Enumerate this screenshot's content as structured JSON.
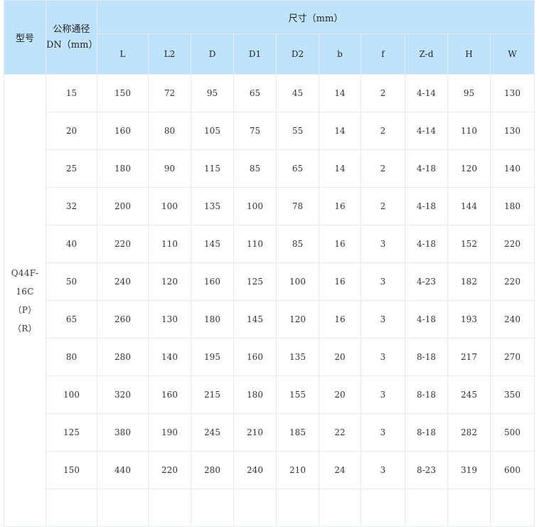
{
  "header": {
    "model_label": "型号",
    "dn_label_line1": "公称通径",
    "dn_label_line2": "DN（mm）",
    "dim_label": "尺寸（mm）",
    "columns": [
      "L",
      "L2",
      "D",
      "D1",
      "D2",
      "b",
      "f",
      "Z-d",
      "H",
      "W"
    ]
  },
  "model": {
    "line1": "Q44F-16C",
    "line2": "（P）",
    "line3": "（R）"
  },
  "rows": [
    [
      "15",
      "150",
      "72",
      "95",
      "65",
      "45",
      "14",
      "2",
      "4-14",
      "95",
      "130"
    ],
    [
      "20",
      "160",
      "80",
      "105",
      "75",
      "55",
      "14",
      "2",
      "4-14",
      "110",
      "130"
    ],
    [
      "25",
      "180",
      "90",
      "115",
      "85",
      "65",
      "14",
      "2",
      "4-18",
      "120",
      "140"
    ],
    [
      "32",
      "200",
      "100",
      "135",
      "100",
      "78",
      "16",
      "2",
      "4-18",
      "144",
      "180"
    ],
    [
      "40",
      "220",
      "110",
      "145",
      "110",
      "85",
      "16",
      "3",
      "4-18",
      "152",
      "220"
    ],
    [
      "50",
      "240",
      "120",
      "160",
      "125",
      "100",
      "16",
      "3",
      "4-23",
      "182",
      "220"
    ],
    [
      "65",
      "260",
      "130",
      "180",
      "145",
      "120",
      "16",
      "3",
      "4-18",
      "193",
      "240"
    ],
    [
      "80",
      "280",
      "140",
      "195",
      "160",
      "135",
      "20",
      "3",
      "8-18",
      "217",
      "270"
    ],
    [
      "100",
      "320",
      "160",
      "215",
      "180",
      "155",
      "20",
      "3",
      "8-18",
      "245",
      "350"
    ],
    [
      "125",
      "380",
      "190",
      "245",
      "210",
      "185",
      "22",
      "3",
      "8-18",
      "282",
      "500"
    ],
    [
      "150",
      "440",
      "220",
      "280",
      "240",
      "210",
      "24",
      "3",
      "8-23",
      "319",
      "600"
    ]
  ]
}
